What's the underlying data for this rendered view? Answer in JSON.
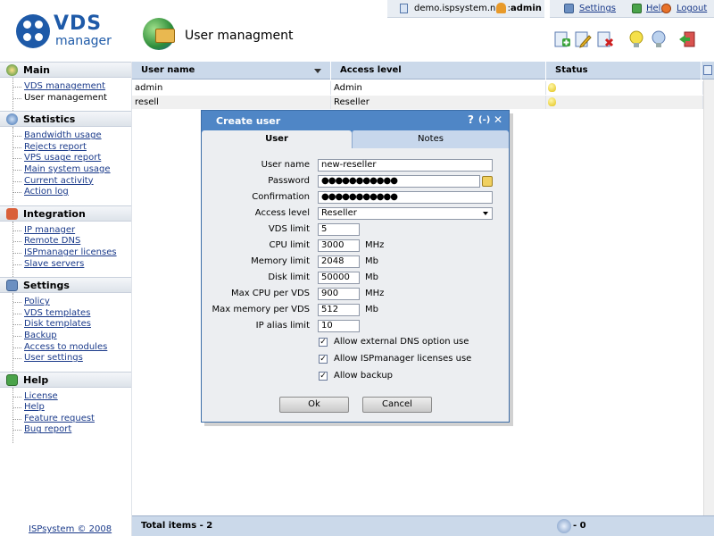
{
  "logo": {
    "line1": "VDS",
    "line2": "manager"
  },
  "header": {
    "page_title": "User managment",
    "host": "demo.ispsystem.net ::",
    "username": "admin",
    "links": {
      "settings": "Settings",
      "help": "Help",
      "logout": "Logout"
    }
  },
  "sidebar": {
    "sections": [
      {
        "title": "Main",
        "items": [
          "VDS management",
          "User management"
        ]
      },
      {
        "title": "Statistics",
        "items": [
          "Bandwidth usage",
          "Rejects report",
          "VPS usage report",
          "Main system usage",
          "Current activity",
          "Action log"
        ]
      },
      {
        "title": "Integration",
        "items": [
          "IP manager",
          "Remote DNS",
          "ISPmanager licenses",
          "Slave servers"
        ]
      },
      {
        "title": "Settings",
        "items": [
          "Policy",
          "VDS templates",
          "Disk templates",
          "Backup",
          "Access to modules",
          "User settings"
        ]
      },
      {
        "title": "Help",
        "items": [
          "License",
          "Help",
          "Feature request",
          "Bug report"
        ]
      }
    ],
    "copyright": "ISPsystem © 2008"
  },
  "table": {
    "columns": [
      "User name",
      "Access level",
      "Status"
    ],
    "rows": [
      {
        "name": "admin",
        "level": "Admin"
      },
      {
        "name": "resell",
        "level": "Reseller"
      }
    ],
    "footer_total": "Total items - 2",
    "footer_count": "- 0"
  },
  "dialog": {
    "title": "Create user",
    "controls": {
      "help": "?",
      "resize": "(-)",
      "close": "✕"
    },
    "tabs": [
      "User",
      "Notes"
    ],
    "fields": {
      "user_name": {
        "label": "User name",
        "value": "new-reseller"
      },
      "password": {
        "label": "Password",
        "value": "●●●●●●●●●●●"
      },
      "confirmation": {
        "label": "Confirmation",
        "value": "●●●●●●●●●●●"
      },
      "access_level": {
        "label": "Access level",
        "value": "Reseller"
      },
      "vds_limit": {
        "label": "VDS limit",
        "value": "5"
      },
      "cpu_limit": {
        "label": "CPU limit",
        "value": "3000",
        "unit": "MHz"
      },
      "memory_limit": {
        "label": "Memory limit",
        "value": "2048",
        "unit": "Mb"
      },
      "disk_limit": {
        "label": "Disk limit",
        "value": "50000",
        "unit": "Mb"
      },
      "max_cpu": {
        "label": "Max CPU per VDS",
        "value": "900",
        "unit": "MHz"
      },
      "max_memory": {
        "label": "Max memory per VDS",
        "value": "512",
        "unit": "Mb"
      },
      "ip_alias": {
        "label": "IP alias limit",
        "value": "10"
      }
    },
    "checkboxes": [
      {
        "label": "Allow external DNS option use",
        "checked": true
      },
      {
        "label": "Allow ISPmanager licenses use",
        "checked": true
      },
      {
        "label": "Allow backup",
        "checked": true
      }
    ],
    "check_mark": "✓",
    "buttons": {
      "ok": "Ok",
      "cancel": "Cancel"
    }
  },
  "icons": {
    "toolbar": [
      "add-user-icon",
      "edit-user-icon",
      "delete-user-icon",
      "enable-bulb-icon",
      "disable-bulb-icon",
      "login-as-user-icon"
    ]
  },
  "colors": {
    "brand": "#1e5aa8",
    "dialog": "#4f86c6",
    "grid_header": "#cbd9ea"
  }
}
